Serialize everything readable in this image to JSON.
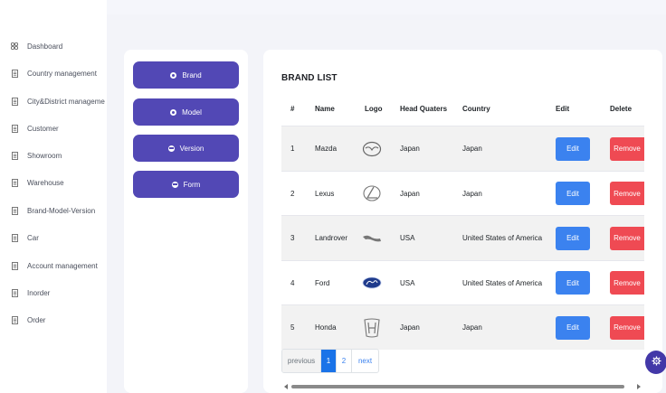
{
  "sidebar": {
    "items": [
      {
        "label": "Dashboard",
        "icon": "grid-icon"
      },
      {
        "label": "Country management",
        "icon": "document-icon"
      },
      {
        "label": "City&District management",
        "icon": "document-icon"
      },
      {
        "label": "Customer",
        "icon": "document-icon"
      },
      {
        "label": "Showroom",
        "icon": "document-icon"
      },
      {
        "label": "Warehouse",
        "icon": "document-icon"
      },
      {
        "label": "Brand-Model-Version",
        "icon": "document-icon"
      },
      {
        "label": "Car",
        "icon": "document-icon"
      },
      {
        "label": "Account management",
        "icon": "document-icon"
      },
      {
        "label": "Inorder",
        "icon": "document-icon"
      },
      {
        "label": "Order",
        "icon": "document-icon"
      }
    ]
  },
  "menu_buttons": [
    {
      "label": "Brand",
      "icon": "dot-icon"
    },
    {
      "label": "Model",
      "icon": "dot-icon"
    },
    {
      "label": "Version",
      "icon": "minus-circle-icon"
    },
    {
      "label": "Form",
      "icon": "minus-circle-icon"
    }
  ],
  "brand_list": {
    "title": "BRAND LIST",
    "columns": [
      "#",
      "Name",
      "Logo",
      "Head Quaters",
      "Country",
      "Edit",
      "Delete"
    ],
    "rows": [
      {
        "num": "1",
        "name": "Mazda",
        "logo": "mazda-logo-icon",
        "hq": "Japan",
        "country": "Japan",
        "edit": "Edit",
        "remove": "Remove"
      },
      {
        "num": "2",
        "name": "Lexus",
        "logo": "lexus-logo-icon",
        "hq": "Japan",
        "country": "Japan",
        "edit": "Edit",
        "remove": "Remove"
      },
      {
        "num": "3",
        "name": "Landrover",
        "logo": "jaguar-logo-icon",
        "hq": "USA",
        "country": "United States of America",
        "edit": "Edit",
        "remove": "Remove"
      },
      {
        "num": "4",
        "name": "Ford",
        "logo": "ford-logo-icon",
        "hq": "USA",
        "country": "United States of America",
        "edit": "Edit",
        "remove": "Remove"
      },
      {
        "num": "5",
        "name": "Honda",
        "logo": "honda-logo-icon",
        "hq": "Japan",
        "country": "Japan",
        "edit": "Edit",
        "remove": "Remove"
      }
    ]
  },
  "pagination": {
    "previous": "previous",
    "page1": "1",
    "page2": "2",
    "next": "next"
  },
  "colors": {
    "primary_purple": "#5248b5",
    "edit_blue": "#3b82ef",
    "remove_red": "#ef4a53",
    "active_page": "#1a73e8"
  }
}
